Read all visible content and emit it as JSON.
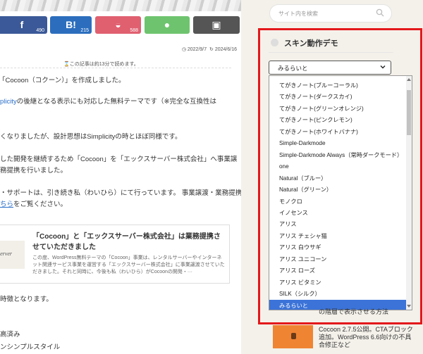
{
  "share": {
    "facebook": {
      "icon": "f",
      "count": "490"
    },
    "hatena": {
      "icon": "B!",
      "count": "215"
    },
    "pocket": {
      "icon": "◒",
      "count": "588"
    },
    "line": {
      "icon": "●"
    },
    "copy": {
      "icon": "▣"
    }
  },
  "article": {
    "published": "2022/9/7",
    "updated": "2024/6/16",
    "readtime": "この記事は約13分で読めます。",
    "lines": [
      "「Cocoon（コクーン）」を作成しました。",
      "plicity",
      "の後継となる表示にも対応した無料テーマです（※完全な互換性は",
      "くなりましたが、設計思想はSimplicityの時とほぼ同様です。",
      "した開発を継続するため「Cocoon」を「エックスサーバー株式会社」へ事業譲",
      "務提携を行いました。",
      "・サポートは、引き続き私（わいひら）にて行っています。 事業譲渡・業務提携",
      "ちら",
      "をご覧ください。",
      "時徴となります。",
      "高済み",
      "ンシンプルスタイル"
    ]
  },
  "card": {
    "thumb": "server",
    "title": "「Cocoon」と「エックスサーバー株式会社」は業務提携させていただきました",
    "desc": "この度、WordPress無料テーマの「Cocoon」事業は、レンタルサーバーやインターネット関連サービス事業を運営する「エックスサーバー株式会社」に事業譲渡させていただきました。それと同時に、今後も私（わいひら）がCocoonの開発・···"
  },
  "sidebar": {
    "search_placeholder": "サイト内を検索",
    "widget_title": "スキン動作デモ",
    "select_value": "みるらいと",
    "options": [
      "てがきノート(ブルーコーラル)",
      "てがきノート(ダークスカイ)",
      "てがきノート(グリーンオレンジ)",
      "てがきノート(ピンクレモン)",
      "てがきノート(ホワイトバナナ)",
      "Simple-Darkmode",
      "Simple-Darkmode Always（常時ダークモード）",
      "one",
      "Natural（ブルー）",
      "Natural（グリーン）",
      "モノクロ",
      "イノセンス",
      "アリス",
      "アリス チェシャ猫",
      "アリス 白ウサギ",
      "アリス ユニコーン",
      "アリス ローズ",
      "アリス ビタミン",
      "SILK（シルク）",
      "みるらいと"
    ],
    "selected_index": 19,
    "post_partial": "の階層で表示させる方法",
    "post_text": "Cocoon 2.7.5公開。CTAブロック追加。WordPress 6.6向けの不具合修正など"
  },
  "colors": {
    "highlight": "#e3181b",
    "selected": "#3b73d8",
    "link": "#2a6ec9"
  }
}
